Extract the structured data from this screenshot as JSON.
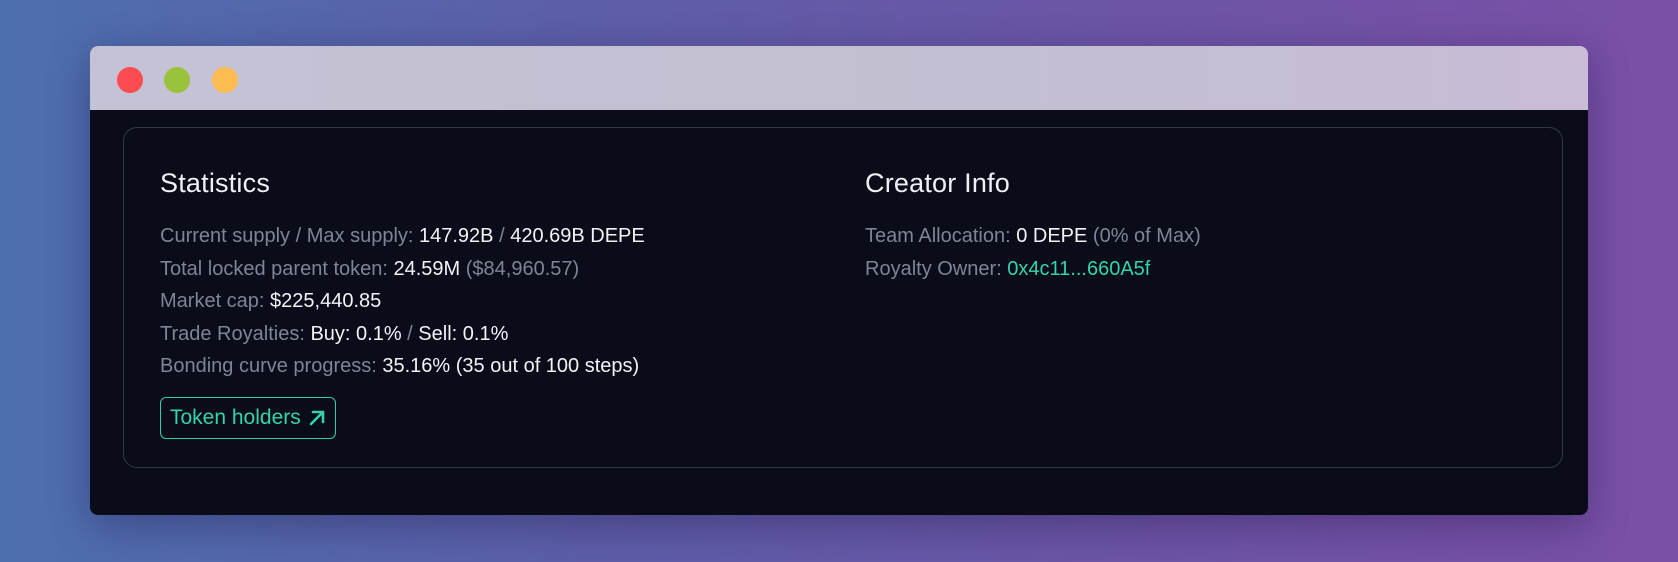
{
  "window": {
    "controls": [
      "close",
      "minimize",
      "maximize"
    ]
  },
  "statistics": {
    "title": "Statistics",
    "current_supply_label": "Current supply / Max supply:",
    "current_supply": "147.92B",
    "supply_separator": "/",
    "max_supply": "420.69B DEPE",
    "locked_label": "Total locked parent token:",
    "locked_value": "24.59M",
    "locked_usd": "($84,960.57)",
    "market_cap_label": "Market cap:",
    "market_cap_value": "$225,440.85",
    "royalties_label": "Trade Royalties:",
    "royalties_buy": "Buy: 0.1%",
    "royalties_separator": "/",
    "royalties_sell": "Sell: 0.1%",
    "bonding_label": "Bonding curve progress:",
    "bonding_value": "35.16% (35 out of 100 steps)",
    "token_holders_button": "Token holders",
    "token_holders_icon": "arrow-up-right-icon"
  },
  "creator_info": {
    "title": "Creator Info",
    "team_allocation_label": "Team Allocation:",
    "team_allocation_value": "0 DEPE",
    "team_allocation_pct": "(0% of Max)",
    "royalty_owner_label": "Royalty Owner:",
    "royalty_owner_value": "0x4c11...660A5f"
  },
  "colors": {
    "accent": "#35d4a8",
    "background": "#0a0c19",
    "muted_text": "#7f8496",
    "value_text": "#f2f3f7"
  }
}
